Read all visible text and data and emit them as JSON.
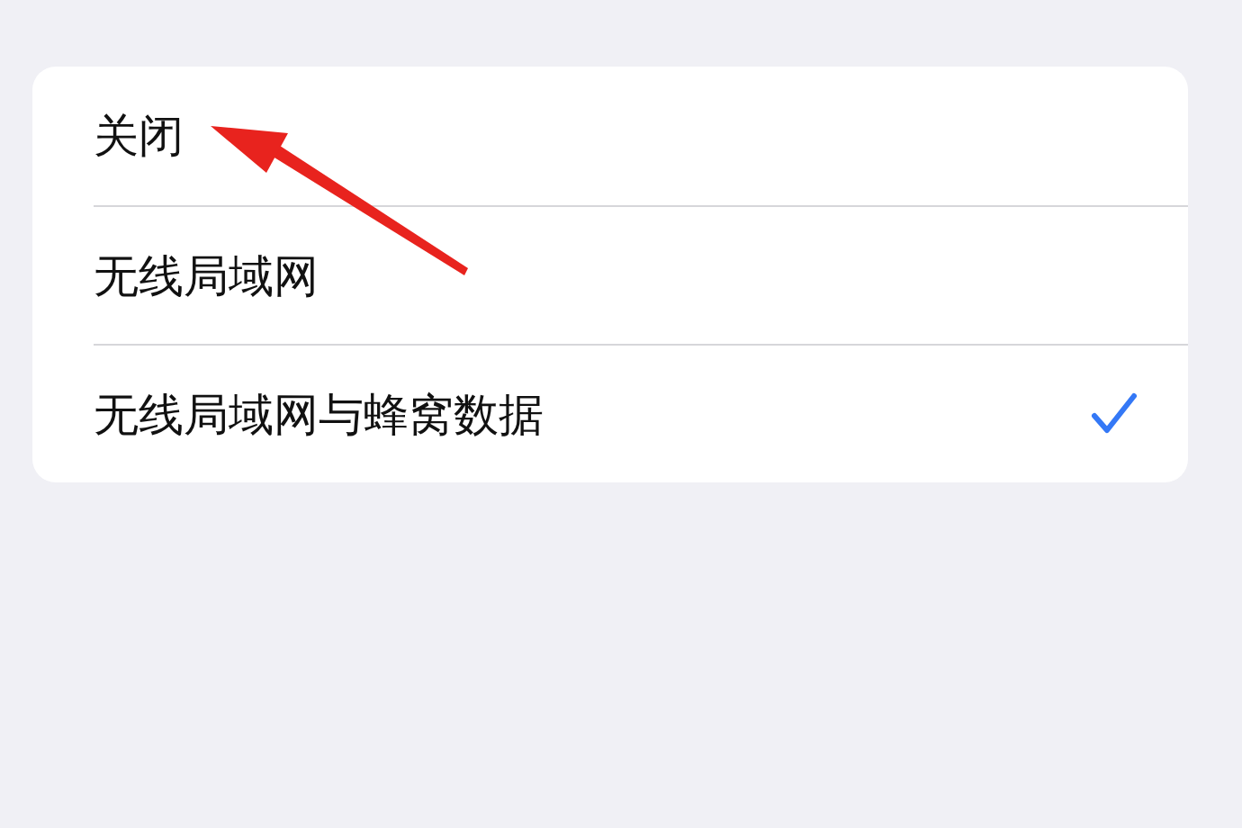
{
  "options": [
    {
      "label": "关闭",
      "selected": false
    },
    {
      "label": "无线局域网",
      "selected": false
    },
    {
      "label": "无线局域网与蜂窝数据",
      "selected": true
    }
  ]
}
